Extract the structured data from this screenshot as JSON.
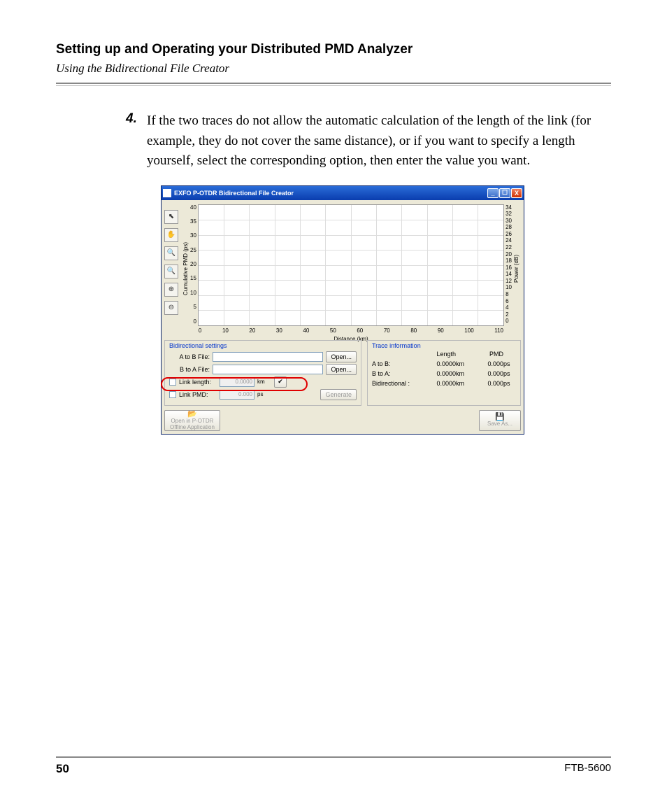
{
  "header": {
    "title": "Setting up and Operating your Distributed PMD Analyzer",
    "subtitle": "Using the Bidirectional File Creator"
  },
  "step": {
    "number": "4.",
    "text": "If the two traces do not allow the automatic calculation of the length of the link (for example, they do not cover the same distance), or if you want to specify a length yourself, select the corresponding option, then enter the value you want."
  },
  "dialog": {
    "title": "EXFO P-OTDR Bidirectional File Creator",
    "window_buttons": {
      "min": "_",
      "max": "☐",
      "close": "X"
    },
    "tools": [
      "⬉",
      "✋",
      "🔍",
      "🔍",
      "⊕",
      "⊖"
    ]
  },
  "chart_data": {
    "type": "line",
    "series": [],
    "xlabel": "Distance (km)",
    "ylabel_left": "Cumulative PMD (ps)",
    "ylabel_right": "Power (dB)",
    "xticks": [
      "0",
      "10",
      "20",
      "30",
      "40",
      "50",
      "60",
      "70",
      "80",
      "90",
      "100",
      "110"
    ],
    "yticks_left": [
      "40",
      "35",
      "30",
      "25",
      "20",
      "15",
      "10",
      "5",
      "0"
    ],
    "yticks_right": [
      "34",
      "32",
      "30",
      "28",
      "26",
      "24",
      "22",
      "20",
      "18",
      "16",
      "14",
      "12",
      "10",
      "8",
      "6",
      "4",
      "2",
      "0"
    ],
    "xlim": [
      0,
      110
    ],
    "ylim_left": [
      0,
      40
    ],
    "ylim_right": [
      0,
      34
    ]
  },
  "settings": {
    "panel_title": "Bidirectional settings",
    "a_to_b_label": "A to B File:",
    "b_to_a_label": "B to A File:",
    "open_btn": "Open...",
    "link_length_label": "Link length:",
    "link_length_value": "0.0000",
    "link_length_unit": "km",
    "check_mark": "✔",
    "link_pmd_label": "Link PMD:",
    "link_pmd_value": "0.000",
    "link_pmd_unit": "ps",
    "generate_btn": "Generate"
  },
  "trace": {
    "panel_title": "Trace information",
    "col_length": "Length",
    "col_pmd": "PMD",
    "rows": [
      {
        "label": "A to B:",
        "len": "0.0000",
        "lu": "km",
        "pmd": "0.000",
        "pu": "ps"
      },
      {
        "label": "B to A:",
        "len": "0.0000",
        "lu": "km",
        "pmd": "0.000",
        "pu": "ps"
      },
      {
        "label": "Bidirectional :",
        "len": "0.0000",
        "lu": "km",
        "pmd": "0.000",
        "pu": "ps"
      }
    ]
  },
  "bottom": {
    "open_offline_icon": "📂",
    "open_offline": "Open in P-OTDR Offline Application",
    "save_icon": "💾",
    "save_as": "Save As..."
  },
  "footer": {
    "page": "50",
    "model": "FTB-5600"
  }
}
